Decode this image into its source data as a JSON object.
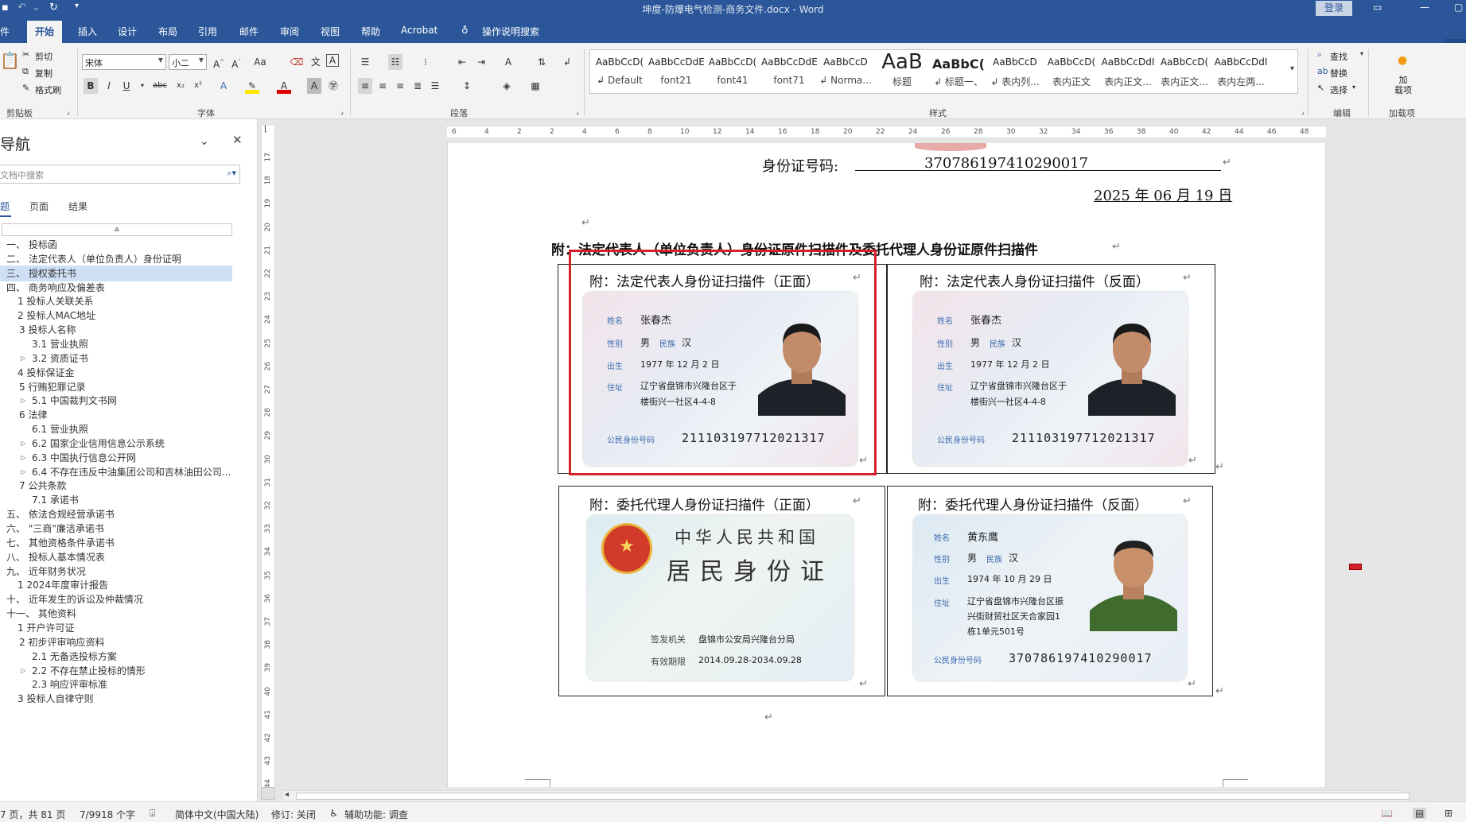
{
  "window": {
    "title": "坤度-防爆电气检测-商务文件.docx - Word",
    "login_label": "登录"
  },
  "ribbon_tabs": [
    "件",
    "开始",
    "插入",
    "设计",
    "布局",
    "引用",
    "邮件",
    "审阅",
    "视图",
    "帮助",
    "Acrobat",
    "操作说明搜索"
  ],
  "clipboard": {
    "cut": "剪切",
    "copy": "复制",
    "format_painter": "格式刷",
    "group": "剪贴板"
  },
  "font": {
    "name": "宋体",
    "size": "小二",
    "group": "字体"
  },
  "paragraph": {
    "group": "段落"
  },
  "styles": {
    "group": "样式",
    "items": [
      {
        "sample": "AaBbCcD(",
        "name": "↲ Default"
      },
      {
        "sample": "AaBbCcDdE",
        "name": "font21"
      },
      {
        "sample": "AaBbCcD(",
        "name": "font41"
      },
      {
        "sample": "AaBbCcDdEe",
        "name": "font71"
      },
      {
        "sample": "AaBbCcD",
        "name": "↲ Norma..."
      },
      {
        "sample": "AaB",
        "name": "标题"
      },
      {
        "sample": "AaBbC(",
        "name": "↲ 标题一、"
      },
      {
        "sample": "AaBbCcD",
        "name": "↲ 表内列..."
      },
      {
        "sample": "AaBbCcD(",
        "name": "表内正文"
      },
      {
        "sample": "AaBbCcDdI",
        "name": "表内正文..."
      },
      {
        "sample": "AaBbCcD(",
        "name": "表内正文..."
      },
      {
        "sample": "AaBbCcDdI",
        "name": "表内左两..."
      }
    ]
  },
  "editing": {
    "find": "查找",
    "replace": "替换",
    "select": "选择",
    "group": "编辑"
  },
  "addins": {
    "label": "加\n载项",
    "group": "加载项"
  },
  "nav_pane": {
    "title": "导航",
    "search_placeholder": "在文档中搜索",
    "tabs": [
      "标题",
      "页面",
      "结果"
    ],
    "outline": [
      {
        "text": "一、 投标函",
        "indent": 0
      },
      {
        "text": "二、 法定代表人（单位负责人）身份证明",
        "indent": 0
      },
      {
        "text": "三、 授权委托书",
        "indent": 0,
        "selected": true
      },
      {
        "text": "四、 商务响应及偏差表",
        "indent": 0
      },
      {
        "text": "1 投标人关联关系",
        "indent": 1
      },
      {
        "text": "2 投标人MAC地址",
        "indent": 1
      },
      {
        "text": "3 投标人名称",
        "indent": 0,
        "expanded": true
      },
      {
        "text": "3.1 营业执照",
        "indent": 2
      },
      {
        "text": "3.2 资质证书",
        "indent": 2,
        "collapsed": true
      },
      {
        "text": "4 投标保证金",
        "indent": 1
      },
      {
        "text": "5 行贿犯罪记录",
        "indent": 0,
        "expanded": true
      },
      {
        "text": "5.1 中国裁判文书网",
        "indent": 2,
        "collapsed": true
      },
      {
        "text": "6 法律",
        "indent": 0,
        "expanded": true
      },
      {
        "text": "6.1 营业执照",
        "indent": 2
      },
      {
        "text": "6.2 国家企业信用信息公示系统",
        "indent": 2,
        "collapsed": true
      },
      {
        "text": "6.3 中国执行信息公开网",
        "indent": 2,
        "collapsed": true
      },
      {
        "text": "6.4 不存在违反中油集团公司和吉林油田公司...",
        "indent": 2,
        "collapsed": true
      },
      {
        "text": "7 公共条款",
        "indent": 0,
        "expanded": true
      },
      {
        "text": "7.1 承诺书",
        "indent": 2
      },
      {
        "text": "五、 依法合规经营承诺书",
        "indent": 0
      },
      {
        "text": "六、 \"三商\"廉洁承诺书",
        "indent": 0
      },
      {
        "text": "七、 其他资格条件承诺书",
        "indent": 0
      },
      {
        "text": "八、 投标人基本情况表",
        "indent": 0
      },
      {
        "text": "九、 近年财务状况",
        "indent": 0
      },
      {
        "text": "1 2024年度审计报告",
        "indent": 1
      },
      {
        "text": "十、 近年发生的诉讼及仲裁情况",
        "indent": 0
      },
      {
        "text": "十一、 其他资料",
        "indent": 0
      },
      {
        "text": "1 开户许可证",
        "indent": 1
      },
      {
        "text": "2 初步评审响应资料",
        "indent": 0,
        "expanded": true
      },
      {
        "text": "2.1 无备选投标方案",
        "indent": 2
      },
      {
        "text": "2.2 不存在禁止投标的情形",
        "indent": 2,
        "collapsed": true
      },
      {
        "text": "2.3 响应评审标准",
        "indent": 2
      },
      {
        "text": "3 投标人自律守则",
        "indent": 1
      }
    ]
  },
  "ruler_numbers": [
    "6",
    "4",
    "2",
    "2",
    "4",
    "6",
    "8",
    "10",
    "12",
    "14",
    "16",
    "18",
    "20",
    "22",
    "24",
    "26",
    "28",
    "30",
    "32",
    "34",
    "36",
    "38",
    "40",
    "42",
    "44",
    "46",
    "48"
  ],
  "vruler_numbers": [
    "17",
    "18",
    "19",
    "20",
    "21",
    "22",
    "23",
    "24",
    "25",
    "26",
    "27",
    "28",
    "29",
    "30",
    "31",
    "32",
    "33",
    "34",
    "35",
    "36",
    "37",
    "38",
    "39",
    "40",
    "41",
    "42",
    "43",
    "44"
  ],
  "document": {
    "id_label": "身份证号码:",
    "id_value": "370786197410290017",
    "date": "2025 年 06 月 19 日",
    "heading": "附：法定代表人（单位负责人）身份证原件扫描件及委托代理人身份证原件扫描件",
    "cells": [
      {
        "caption": "附：法定代表人身份证扫描件（正面）"
      },
      {
        "caption": "附：法定代表人身份证扫描件（反面）"
      },
      {
        "caption": "附：委托代理人身份证扫描件（正面）"
      },
      {
        "caption": "附：委托代理人身份证扫描件（反面）"
      }
    ],
    "card_rep": {
      "name_label": "姓名",
      "name": "张春杰",
      "sex_label": "性别",
      "sex": "男",
      "ethnic_label": "民族",
      "ethnic": "汉",
      "birth_label": "出生",
      "birth": "1977 年 12 月 2 日",
      "addr_label": "住址",
      "addr1": "辽宁省盘锦市兴隆台区于",
      "addr2": "楼街兴一社区4-4-8",
      "id_label": "公民身份号码",
      "id": "211103197712021317"
    },
    "card_agent_back": {
      "title1": "中华人民共和国",
      "title2": "居民身份证",
      "issuer_label": "签发机关",
      "issuer": "盘锦市公安局兴隆台分局",
      "valid_label": "有效期限",
      "valid": "2014.09.28-2034.09.28"
    },
    "card_agent": {
      "name_label": "姓名",
      "name": "黄东鹰",
      "sex_label": "性别",
      "sex": "男",
      "ethnic_label": "民族",
      "ethnic": "汉",
      "birth_label": "出生",
      "birth": "1974 年 10 月 29 日",
      "addr_label": "住址",
      "addr1": "辽宁省盘锦市兴隆台区振",
      "addr2": "兴街财贸社区天合家园1",
      "addr3": "栋1单元501号",
      "id_label": "公民身份号码",
      "id": "370786197410290017"
    }
  },
  "statusbar": {
    "page": "7 页，共 81 页",
    "words": "7/9918 个字",
    "language": "简体中文(中国大陆)",
    "track": "修订: 关闭",
    "accessibility": "辅助功能: 调查"
  },
  "colors": {
    "accent": "#2b579a",
    "highlight_box": "#d4202a"
  }
}
